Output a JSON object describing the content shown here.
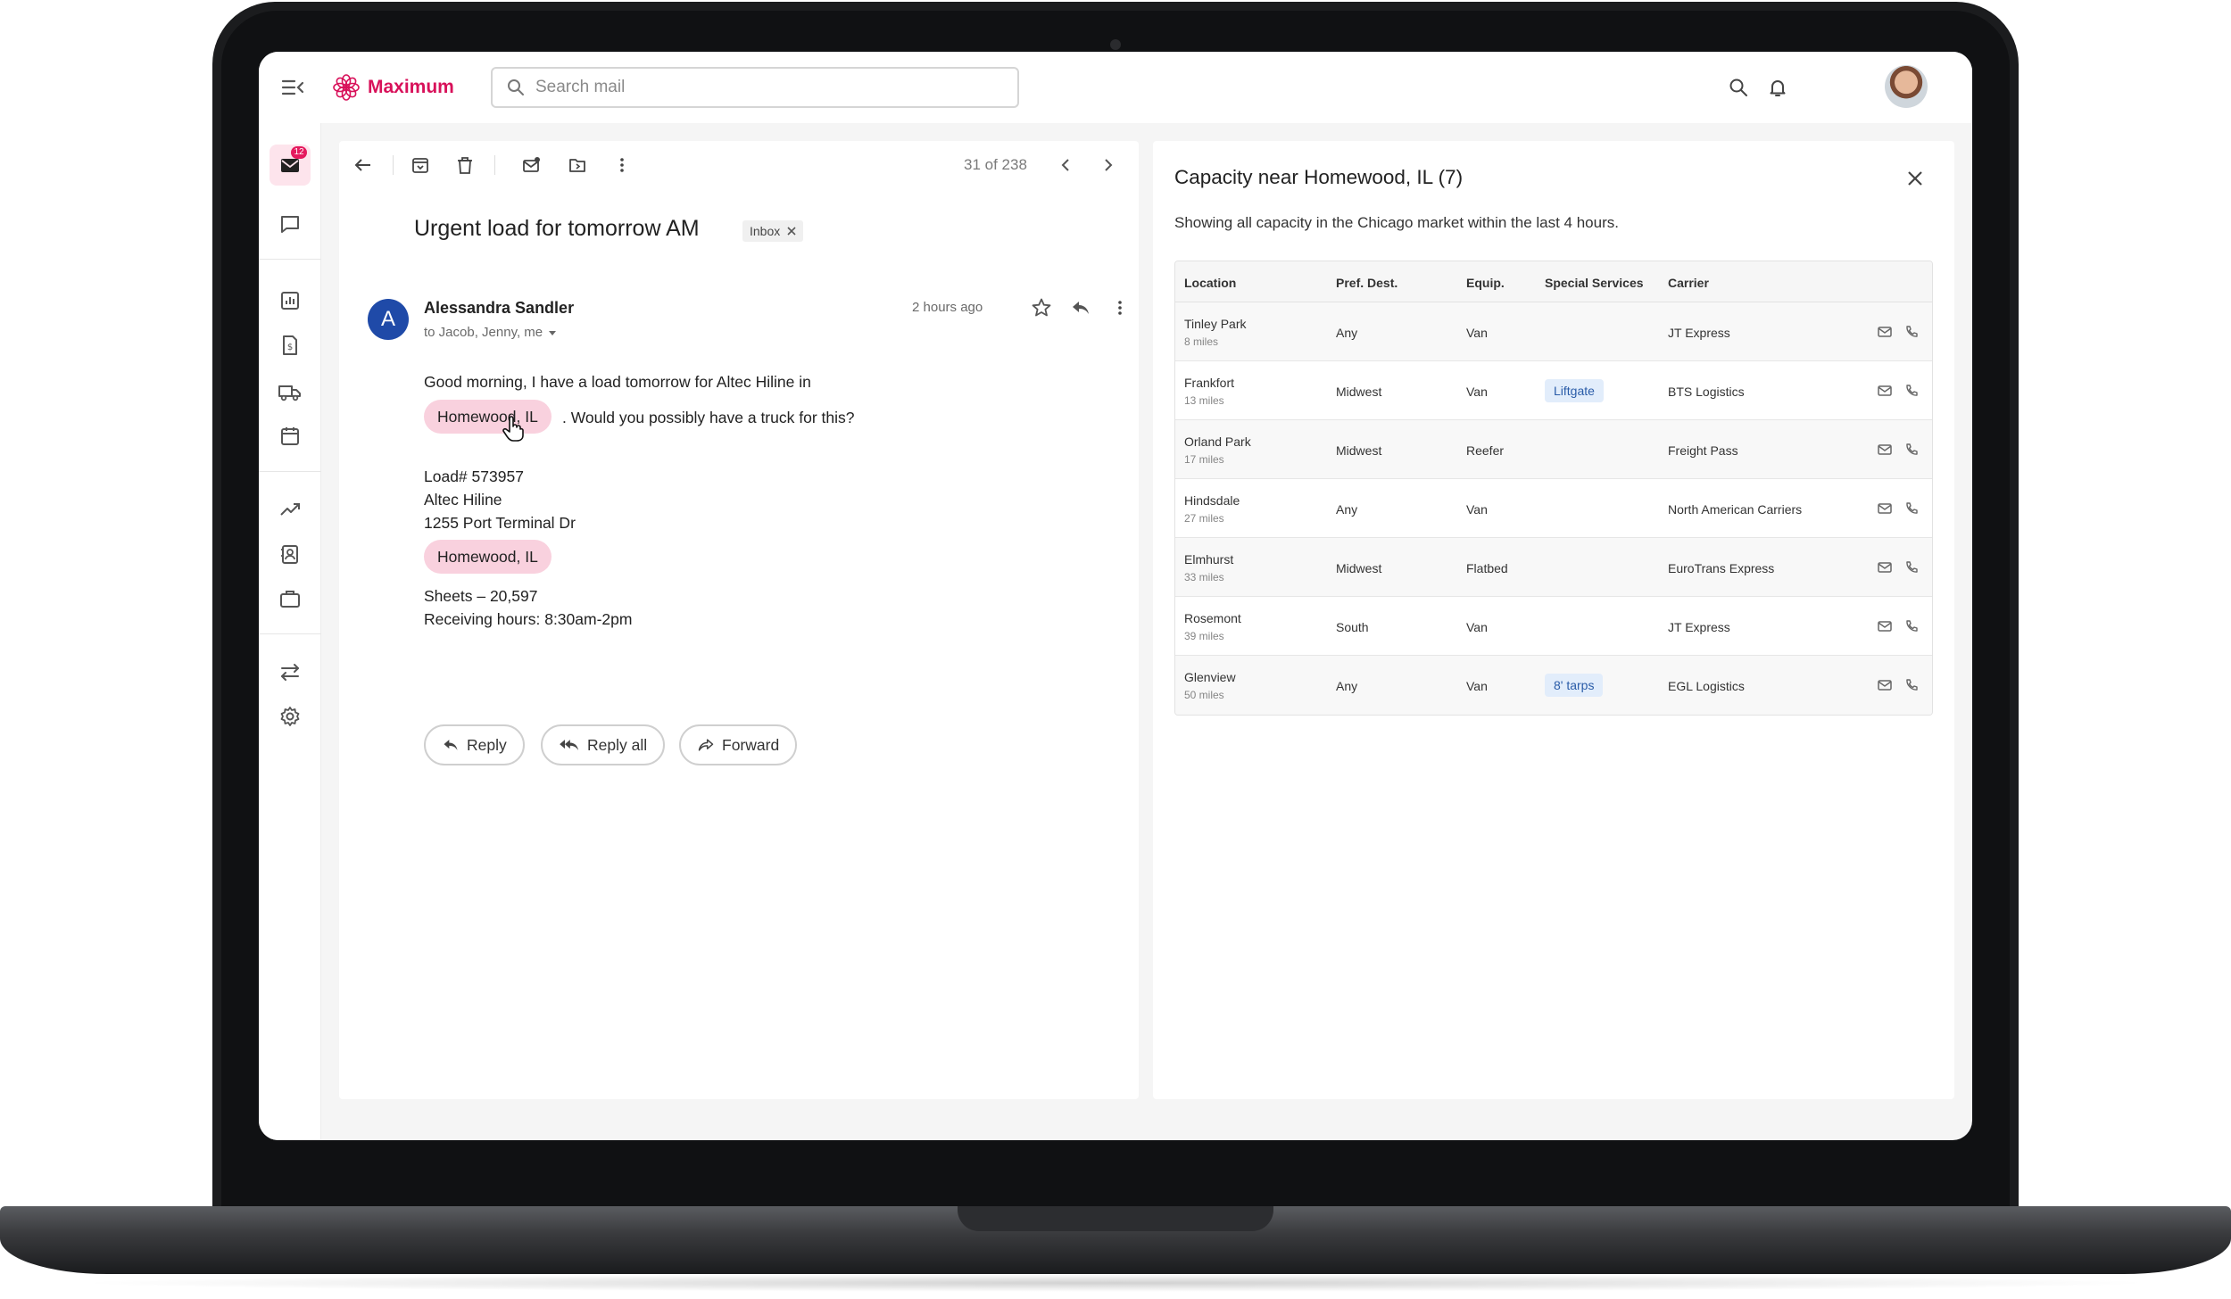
{
  "brand": {
    "name": "Maximum",
    "accent": "#d8115a"
  },
  "search": {
    "placeholder": "Search mail"
  },
  "rail": {
    "mail_badge": "12"
  },
  "toolbar": {
    "pager": "31 of 238"
  },
  "message": {
    "subject": "Urgent load for tomorrow AM",
    "label_chip": "Inbox",
    "sender_initial": "A",
    "sender_name": "Alessandra Sandler",
    "recipients": "to Jacob, Jenny, me",
    "timestamp": "2 hours ago",
    "line1": "Good morning, I have a load tomorrow for Altec Hiline in",
    "location_chip": "Homewood, IL",
    "line2": ". Would you possibly have a truck for this?",
    "load_number": "Load# 573957",
    "company": "Altec Hiline",
    "address": "1255 Port Terminal Dr",
    "location_chip_2": "Homewood, IL",
    "sheets": "Sheets – 20,597",
    "receiving_hours": "Receiving hours: 8:30am-2pm"
  },
  "actions": {
    "reply": "Reply",
    "reply_all": "Reply all",
    "forward": "Forward"
  },
  "capacity": {
    "title": "Capacity near Homewood, IL (7)",
    "subtitle": "Showing all capacity in the Chicago market within the last 4 hours.",
    "columns": [
      "Location",
      "Pref. Dest.",
      "Equip.",
      "Special Services",
      "Carrier"
    ],
    "rows": [
      {
        "location": "Tinley Park",
        "miles": "8 miles",
        "dest": "Any",
        "equip": "Van",
        "service": "",
        "carrier": "JT Express"
      },
      {
        "location": "Frankfort",
        "miles": "13 miles",
        "dest": "Midwest",
        "equip": "Van",
        "service": "Liftgate",
        "carrier": "BTS Logistics"
      },
      {
        "location": "Orland Park",
        "miles": "17 miles",
        "dest": "Midwest",
        "equip": "Reefer",
        "service": "",
        "carrier": "Freight Pass"
      },
      {
        "location": "Hindsdale",
        "miles": "27 miles",
        "dest": "Any",
        "equip": "Van",
        "service": "",
        "carrier": "North American Carriers"
      },
      {
        "location": "Elmhurst",
        "miles": "33 miles",
        "dest": "Midwest",
        "equip": "Flatbed",
        "service": "",
        "carrier": "EuroTrans Express"
      },
      {
        "location": "Rosemont",
        "miles": "39 miles",
        "dest": "South",
        "equip": "Van",
        "service": "",
        "carrier": "JT Express"
      },
      {
        "location": "Glenview",
        "miles": "50 miles",
        "dest": "Any",
        "equip": "Van",
        "service": "8' tarps",
        "carrier": "EGL Logistics"
      }
    ]
  }
}
